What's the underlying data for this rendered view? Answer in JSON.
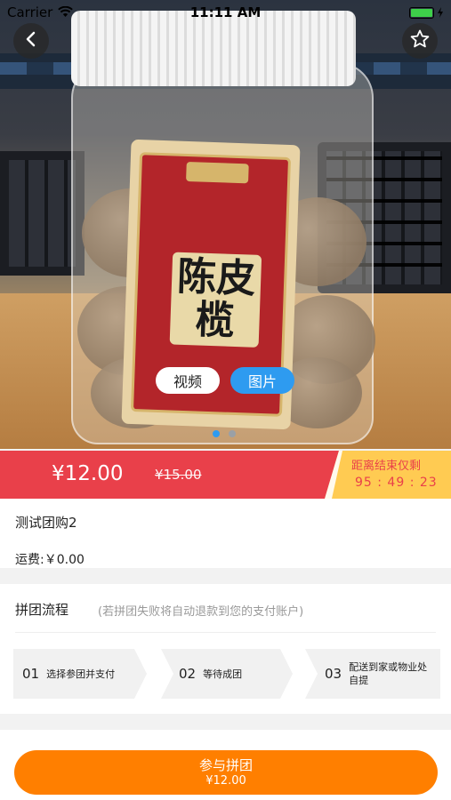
{
  "status_bar": {
    "carrier": "Carrier",
    "time": "11:11 AM"
  },
  "gallery": {
    "video_tab": "视频",
    "image_tab": "图片",
    "active_tab": "image",
    "page_count": 2,
    "active_page": 1,
    "label_text": "陈皮榄"
  },
  "price": {
    "current": "¥12.00",
    "original": "¥15.00",
    "countdown_label": "距离结束仅剩",
    "countdown": "95 : 49 : 23"
  },
  "product": {
    "name": "测试团购2",
    "shipping": "运费:￥0.00"
  },
  "group_process": {
    "title": "拼团流程",
    "note": "(若拼团失败将自动退款到您的支付账户)",
    "steps": [
      {
        "num": "01",
        "text": "选择参团并支付"
      },
      {
        "num": "02",
        "text": "等待成团"
      },
      {
        "num": "03",
        "text": "配送到家或物业处自提"
      }
    ]
  },
  "action": {
    "label": "参与拼团",
    "price": "¥12.00"
  },
  "colors": {
    "price_bar": "#e9404a",
    "countdown_bg": "#ffcb52",
    "primary_button": "#ff7f00",
    "active_tab": "#2e9bf0"
  }
}
